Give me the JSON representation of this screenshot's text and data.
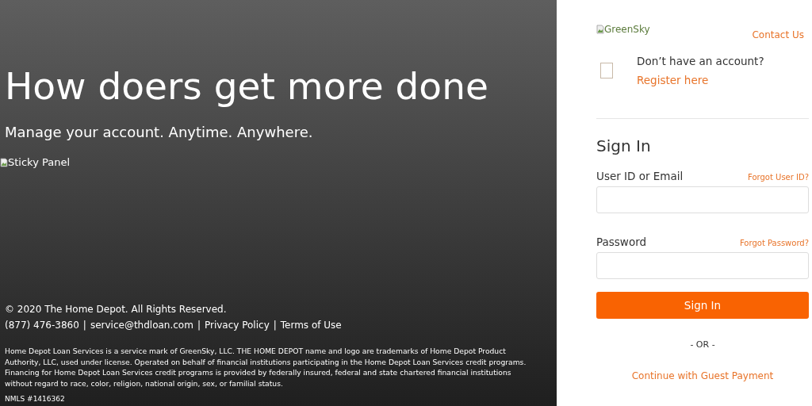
{
  "hero": {
    "headline": "How doers get more done",
    "subtitle": "Manage your account. Anytime. Anywhere.",
    "image_alt": "Sticky Panel"
  },
  "footer": {
    "copyright": "© 2020 The Home Depot. All Rights Reserved.",
    "phone": "(877) 476-3860",
    "links": [
      {
        "separator": "|",
        "text": "service@thdloan.com"
      },
      {
        "separator": "|",
        "text": "Privacy Policy"
      },
      {
        "separator": "|",
        "text": "Terms of Use"
      }
    ],
    "legal": "Home Depot Loan Services is a service mark of GreenSky, LLC. THE HOME DEPOT name and logo are trademarks of Home Depot Product Authority, LLC, used under license. Operated on behalf of financial institutions participating in the Home Depot Loan Services credit programs. Financing for Home Depot Loan Services credit programs is provided by federally insured, federal and state chartered financial institutions without regard to race, color, religion, national origin, sex, or familial status.",
    "nmls": "NMLS #1416362"
  },
  "header": {
    "logo_alt": "GreenSky",
    "contact_link": "Contact Us"
  },
  "register": {
    "prompt": "Don’t have an account?",
    "link": "Register here"
  },
  "sign_in": {
    "title": "Sign In",
    "fields": [
      {
        "label": "User ID or Email",
        "help_link": "Forgot User ID?"
      },
      {
        "label": "Password",
        "help_link": "Forgot Password?"
      }
    ],
    "button": "Sign In",
    "divider": "- OR -",
    "guest_link": "Continue with Guest Payment"
  }
}
